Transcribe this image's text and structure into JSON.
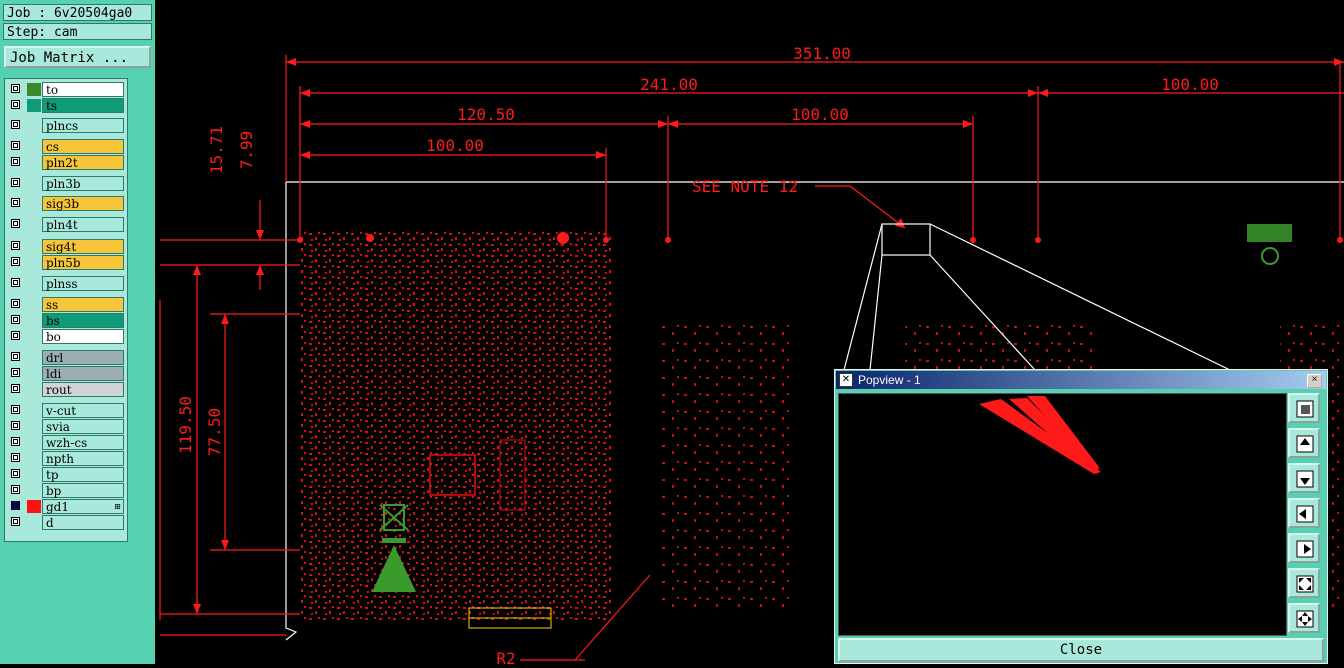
{
  "job": {
    "job_line": "Job : 6v20504ga0",
    "step_line": "Step: cam"
  },
  "job_matrix_label": "Job Matrix ...",
  "layers": [
    {
      "name": "to",
      "bg": "#ffffff",
      "swatch": "#3a8a2c",
      "active": false
    },
    {
      "name": "ts",
      "bg": "#0f9a78",
      "swatch": "#0f9a78",
      "active": false
    },
    {
      "name": "plncs",
      "bg": "#a9e9dc",
      "swatch": "",
      "active": false
    },
    {
      "name": "cs",
      "bg": "#f7c53a",
      "swatch": "",
      "active": false
    },
    {
      "name": "pln2t",
      "bg": "#f7c53a",
      "swatch": "",
      "active": false
    },
    {
      "name": "pln3b",
      "bg": "#a9e9dc",
      "swatch": "",
      "active": false
    },
    {
      "name": "sig3b",
      "bg": "#f7c53a",
      "swatch": "",
      "active": false
    },
    {
      "name": "pln4t",
      "bg": "#a9e9dc",
      "swatch": "",
      "active": false
    },
    {
      "name": "sig4t",
      "bg": "#f7c53a",
      "swatch": "",
      "active": false
    },
    {
      "name": "pln5b",
      "bg": "#f7c53a",
      "swatch": "",
      "active": false
    },
    {
      "name": "plnss",
      "bg": "#a9e9dc",
      "swatch": "",
      "active": false
    },
    {
      "name": "ss",
      "bg": "#f7c53a",
      "swatch": "",
      "active": false
    },
    {
      "name": "bs",
      "bg": "#0f9a78",
      "swatch": "",
      "active": false
    },
    {
      "name": "bo",
      "bg": "#ffffff",
      "swatch": "",
      "active": false
    },
    {
      "name": "drl",
      "bg": "#9aaeb4",
      "swatch": "",
      "active": false
    },
    {
      "name": "ldi",
      "bg": "#9aaeb4",
      "swatch": "",
      "active": false
    },
    {
      "name": "rout",
      "bg": "#d0d4d4",
      "swatch": "",
      "active": false
    },
    {
      "name": "v-cut",
      "bg": "#a9e9dc",
      "swatch": "",
      "active": false
    },
    {
      "name": "svia",
      "bg": "#a9e9dc",
      "swatch": "",
      "active": false
    },
    {
      "name": "wzh-cs",
      "bg": "#a9e9dc",
      "swatch": "",
      "active": false
    },
    {
      "name": "npth",
      "bg": "#a9e9dc",
      "swatch": "",
      "active": false
    },
    {
      "name": "tp",
      "bg": "#a9e9dc",
      "swatch": "",
      "active": false
    },
    {
      "name": "bp",
      "bg": "#a9e9dc",
      "swatch": "",
      "active": false
    },
    {
      "name": "gd1",
      "bg": "#a9e9dc",
      "swatch": "#ff1010",
      "active": true
    },
    {
      "name": "d",
      "bg": "#a9e9dc",
      "swatch": "",
      "active": false
    }
  ],
  "dimensions": {
    "d351": "351.00",
    "d241": "241.00",
    "d100r": "100.00",
    "d120": "120.50",
    "d100m": "100.00",
    "d100l": "100.00",
    "d1571": "15.71",
    "d799": "7.99",
    "d11950": "119.50",
    "d7750": "77.50",
    "note": "SEE NOTE 12",
    "r2": "R2"
  },
  "popview": {
    "title": "Popview - 1",
    "close_label": "Close",
    "close_x": "×"
  },
  "colors": {
    "panel": "#55d1b1",
    "field": "#a9e9dc",
    "accent": "#ff1a1a",
    "silk": "#3a9a2c"
  }
}
